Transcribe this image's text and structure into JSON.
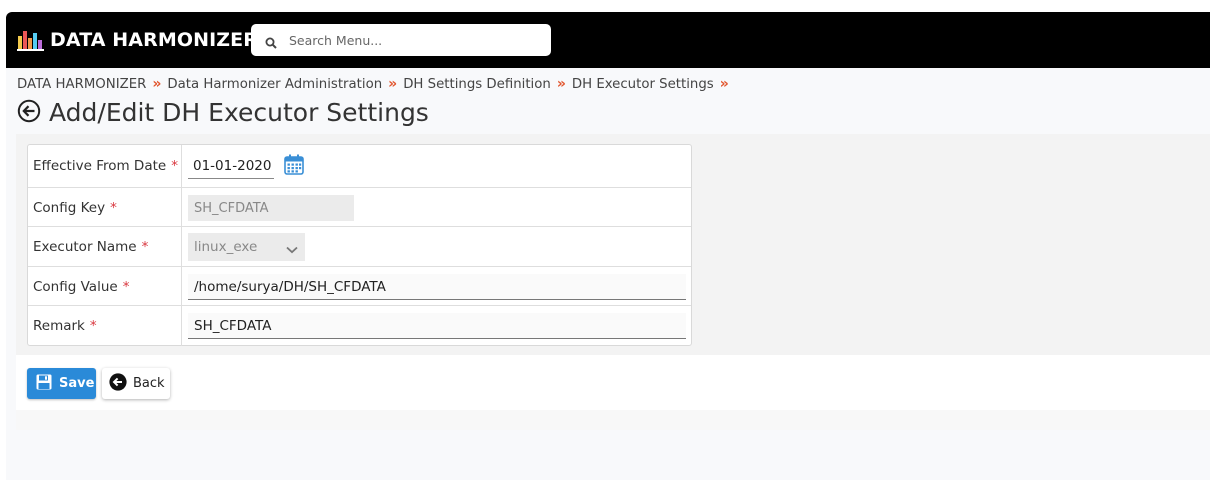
{
  "app": {
    "brand": "DATA HARMONIZER",
    "logo_icon": "bar-chart-logo-icon"
  },
  "search": {
    "placeholder": "Search Menu...",
    "value": ""
  },
  "breadcrumb": {
    "items": [
      "DATA HARMONIZER",
      "Data Harmonizer Administration",
      "DH Settings Definition",
      "DH Executor Settings"
    ],
    "separator": "»"
  },
  "page": {
    "title": "Add/Edit DH Executor Settings"
  },
  "form": {
    "required_mark": "*",
    "effective_from": {
      "label": "Effective From Date",
      "value": "01-01-2020"
    },
    "config_key": {
      "label": "Config Key",
      "value": "SH_CFDATA"
    },
    "executor_name": {
      "label": "Executor Name",
      "value": "linux_exe"
    },
    "config_value": {
      "label": "Config Value",
      "value": "/home/surya/DH/SH_CFDATA"
    },
    "remark": {
      "label": "Remark",
      "value": "SH_CFDATA"
    }
  },
  "actions": {
    "save_label": "Save",
    "back_label": "Back"
  },
  "colors": {
    "topbar": "#000000",
    "accent_save": "#2a8ad8",
    "breadcrumb_separator": "#e2572f",
    "required": "#d9363e",
    "calendar": "#3a8fd6"
  }
}
